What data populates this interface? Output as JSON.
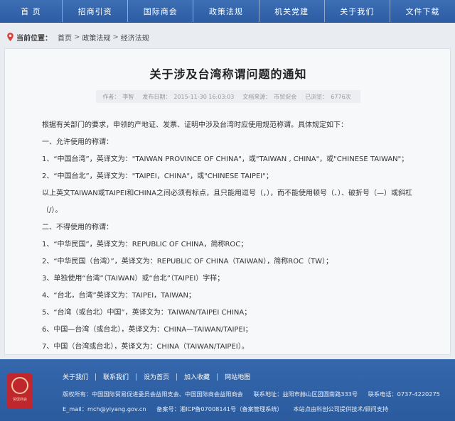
{
  "nav": {
    "items": [
      "首 页",
      "招商引资",
      "国际商会",
      "政策法规",
      "机关党建",
      "关于我们",
      "文件下载"
    ]
  },
  "breadcrumb": {
    "label": "当前位置：",
    "items": [
      "首页",
      "政策法规",
      "经济法规"
    ],
    "separator": ">"
  },
  "article": {
    "title": "关于涉及台湾称谓问题的通知",
    "meta": {
      "author_label": "作者：",
      "author": "李智",
      "date_label": "发布日期：",
      "date": "2015-11-30 16:03:03",
      "source_label": "文档来源：",
      "source": "市贸促会",
      "views_label": "已浏览：",
      "views": "6776次"
    },
    "paragraphs": [
      "根据有关部门的要求，申领的产地证、发票、证明中涉及台湾时应使用规范称谓。具体规定如下：",
      "一、允许使用的称谓：",
      "1、“中国台湾”，英译文为：\"TAIWAN PROVINCE OF CHINA\"，或\"TAIWAN , CHINA\"，或\"CHINESE TAIWAN\"；",
      "2、“中国台北”，英译文为：\"TAIPEI，CHINA\"，或\"CHINESE TAIPEI\"；",
      "以上英文TAIWAN或TAIPEI和CHINA之间必须有标点，且只能用逗号（，），而不能使用顿号（、）、破折号（—）或斜杠（/）。",
      "二、不得使用的称谓：",
      "1、“中华民国”，英译文为：REPUBLIC OF CHINA，简称ROC；",
      "2、“中华民国（台湾）”，英译文为：REPUBLIC OF CHINA（TAIWAN），简称ROC（TW）；",
      "3、单独使用“台湾”（TAIWAN）或“台北”（TAIPEI）字样；",
      "4、“台北，台湾”英译文为：TAIPEI，TAIWAN；",
      "5、“台湾（或台北）中国”，英译文为：TAIWAN/TAIPEI CHINA；",
      "6、中国—台湾（或台北），英译文为：CHINA—TAIWAN/TAIPEI；",
      "7、中国（台湾或台北），英译文为：CHINA（TAIWAN/TAIPEI）。"
    ]
  },
  "footer": {
    "links": [
      "关于我们",
      "联系我们",
      "设为首页",
      "加入收藏",
      "网站地图"
    ],
    "copyright": "版权所有：中国国际贸易促进委员会益阳支会、中国国际商会益阳商会",
    "address": "联系地址：益阳市赫山区团圆南路333号",
    "phone": "联系电话：0737-4220275",
    "email": "E_mail：mch@yiyang.gov.cn",
    "icp": "备案号：湘ICP备07008141号（备案管理系统）",
    "support": "本站点由科创公司提供技术/顾问支持",
    "seal_text": "贸促商会"
  },
  "colors": {
    "nav_bg": "#3d6fb5",
    "footer_bg": "#3567ad",
    "seal": "#c0262d",
    "page_bg": "#e9ecf1"
  }
}
